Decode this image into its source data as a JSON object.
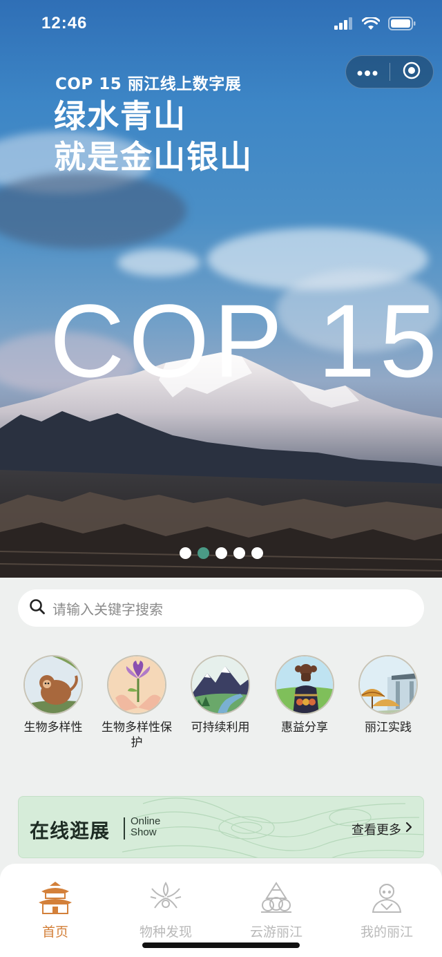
{
  "status_bar": {
    "time": "12:46"
  },
  "hero": {
    "subtitle": "COP 15  丽江线上数字展",
    "line1": "绿水青山",
    "line2": "就是金山银山",
    "big": "COP 15",
    "dots_total": 5,
    "active_dot": 2
  },
  "search": {
    "placeholder": "请输入关键字搜索"
  },
  "categories": [
    {
      "label": "生物多样性",
      "icon": "monkey-icon"
    },
    {
      "label": "生物多样性保护",
      "icon": "flower-hands-icon"
    },
    {
      "label": "可持续利用",
      "icon": "mountain-river-icon"
    },
    {
      "label": "惠益分享",
      "icon": "ethnic-figure-icon"
    },
    {
      "label": "丽江实践",
      "icon": "umbrella-gate-icon"
    }
  ],
  "banner": {
    "title": "在线逛展",
    "en_line1": "Online",
    "en_line2": "Show",
    "more": "查看更多"
  },
  "tabs": [
    {
      "label": "首页",
      "icon": "pavilion-icon",
      "active": true
    },
    {
      "label": "物种发现",
      "icon": "species-icon",
      "active": false
    },
    {
      "label": "云游丽江",
      "icon": "cloud-tour-icon",
      "active": false
    },
    {
      "label": "我的丽江",
      "icon": "profile-icon",
      "active": false
    }
  ],
  "colors": {
    "accent": "#d3803a",
    "active_dot": "#4a9a86",
    "banner_bg": "#d6ecd9",
    "tab_inactive": "#b9b9b9"
  }
}
